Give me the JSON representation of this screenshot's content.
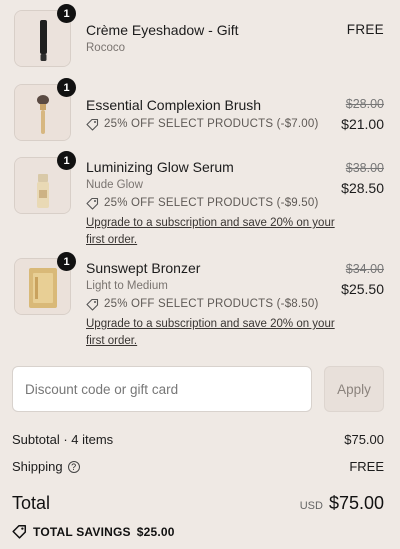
{
  "items": [
    {
      "name": "Crème Eyeshadow - Gift",
      "variant": "Rococo",
      "quantity": "1",
      "price": "FREE"
    },
    {
      "name": "Essential Complexion Brush",
      "discount": "25% OFF SELECT PRODUCTS (-$7.00)",
      "quantity": "1",
      "price_original": "$28.00",
      "price": "$21.00"
    },
    {
      "name": "Luminizing Glow Serum",
      "variant": "Nude Glow",
      "discount": "25% OFF SELECT PRODUCTS (-$9.50)",
      "upsell": "Upgrade to a subscription and save 20% on your first order.",
      "quantity": "1",
      "price_original": "$38.00",
      "price": "$28.50"
    },
    {
      "name": "Sunswept Bronzer",
      "variant": "Light to Medium",
      "discount": "25% OFF SELECT PRODUCTS (-$8.50)",
      "upsell": "Upgrade to a subscription and save 20% on your first order.",
      "quantity": "1",
      "price_original": "$34.00",
      "price": "$25.50"
    }
  ],
  "discount_code": {
    "placeholder": "Discount code or gift card",
    "apply_label": "Apply"
  },
  "summary": {
    "subtotal_label": "Subtotal · 4 items",
    "subtotal_value": "$75.00",
    "shipping_label": "Shipping",
    "shipping_value": "FREE",
    "total_label": "Total",
    "currency": "USD",
    "total_value": "$75.00",
    "savings_label": "TOTAL SAVINGS",
    "savings_value": "$25.00"
  },
  "icons": {
    "tag": "tag-icon",
    "help": "question-circle-icon"
  }
}
